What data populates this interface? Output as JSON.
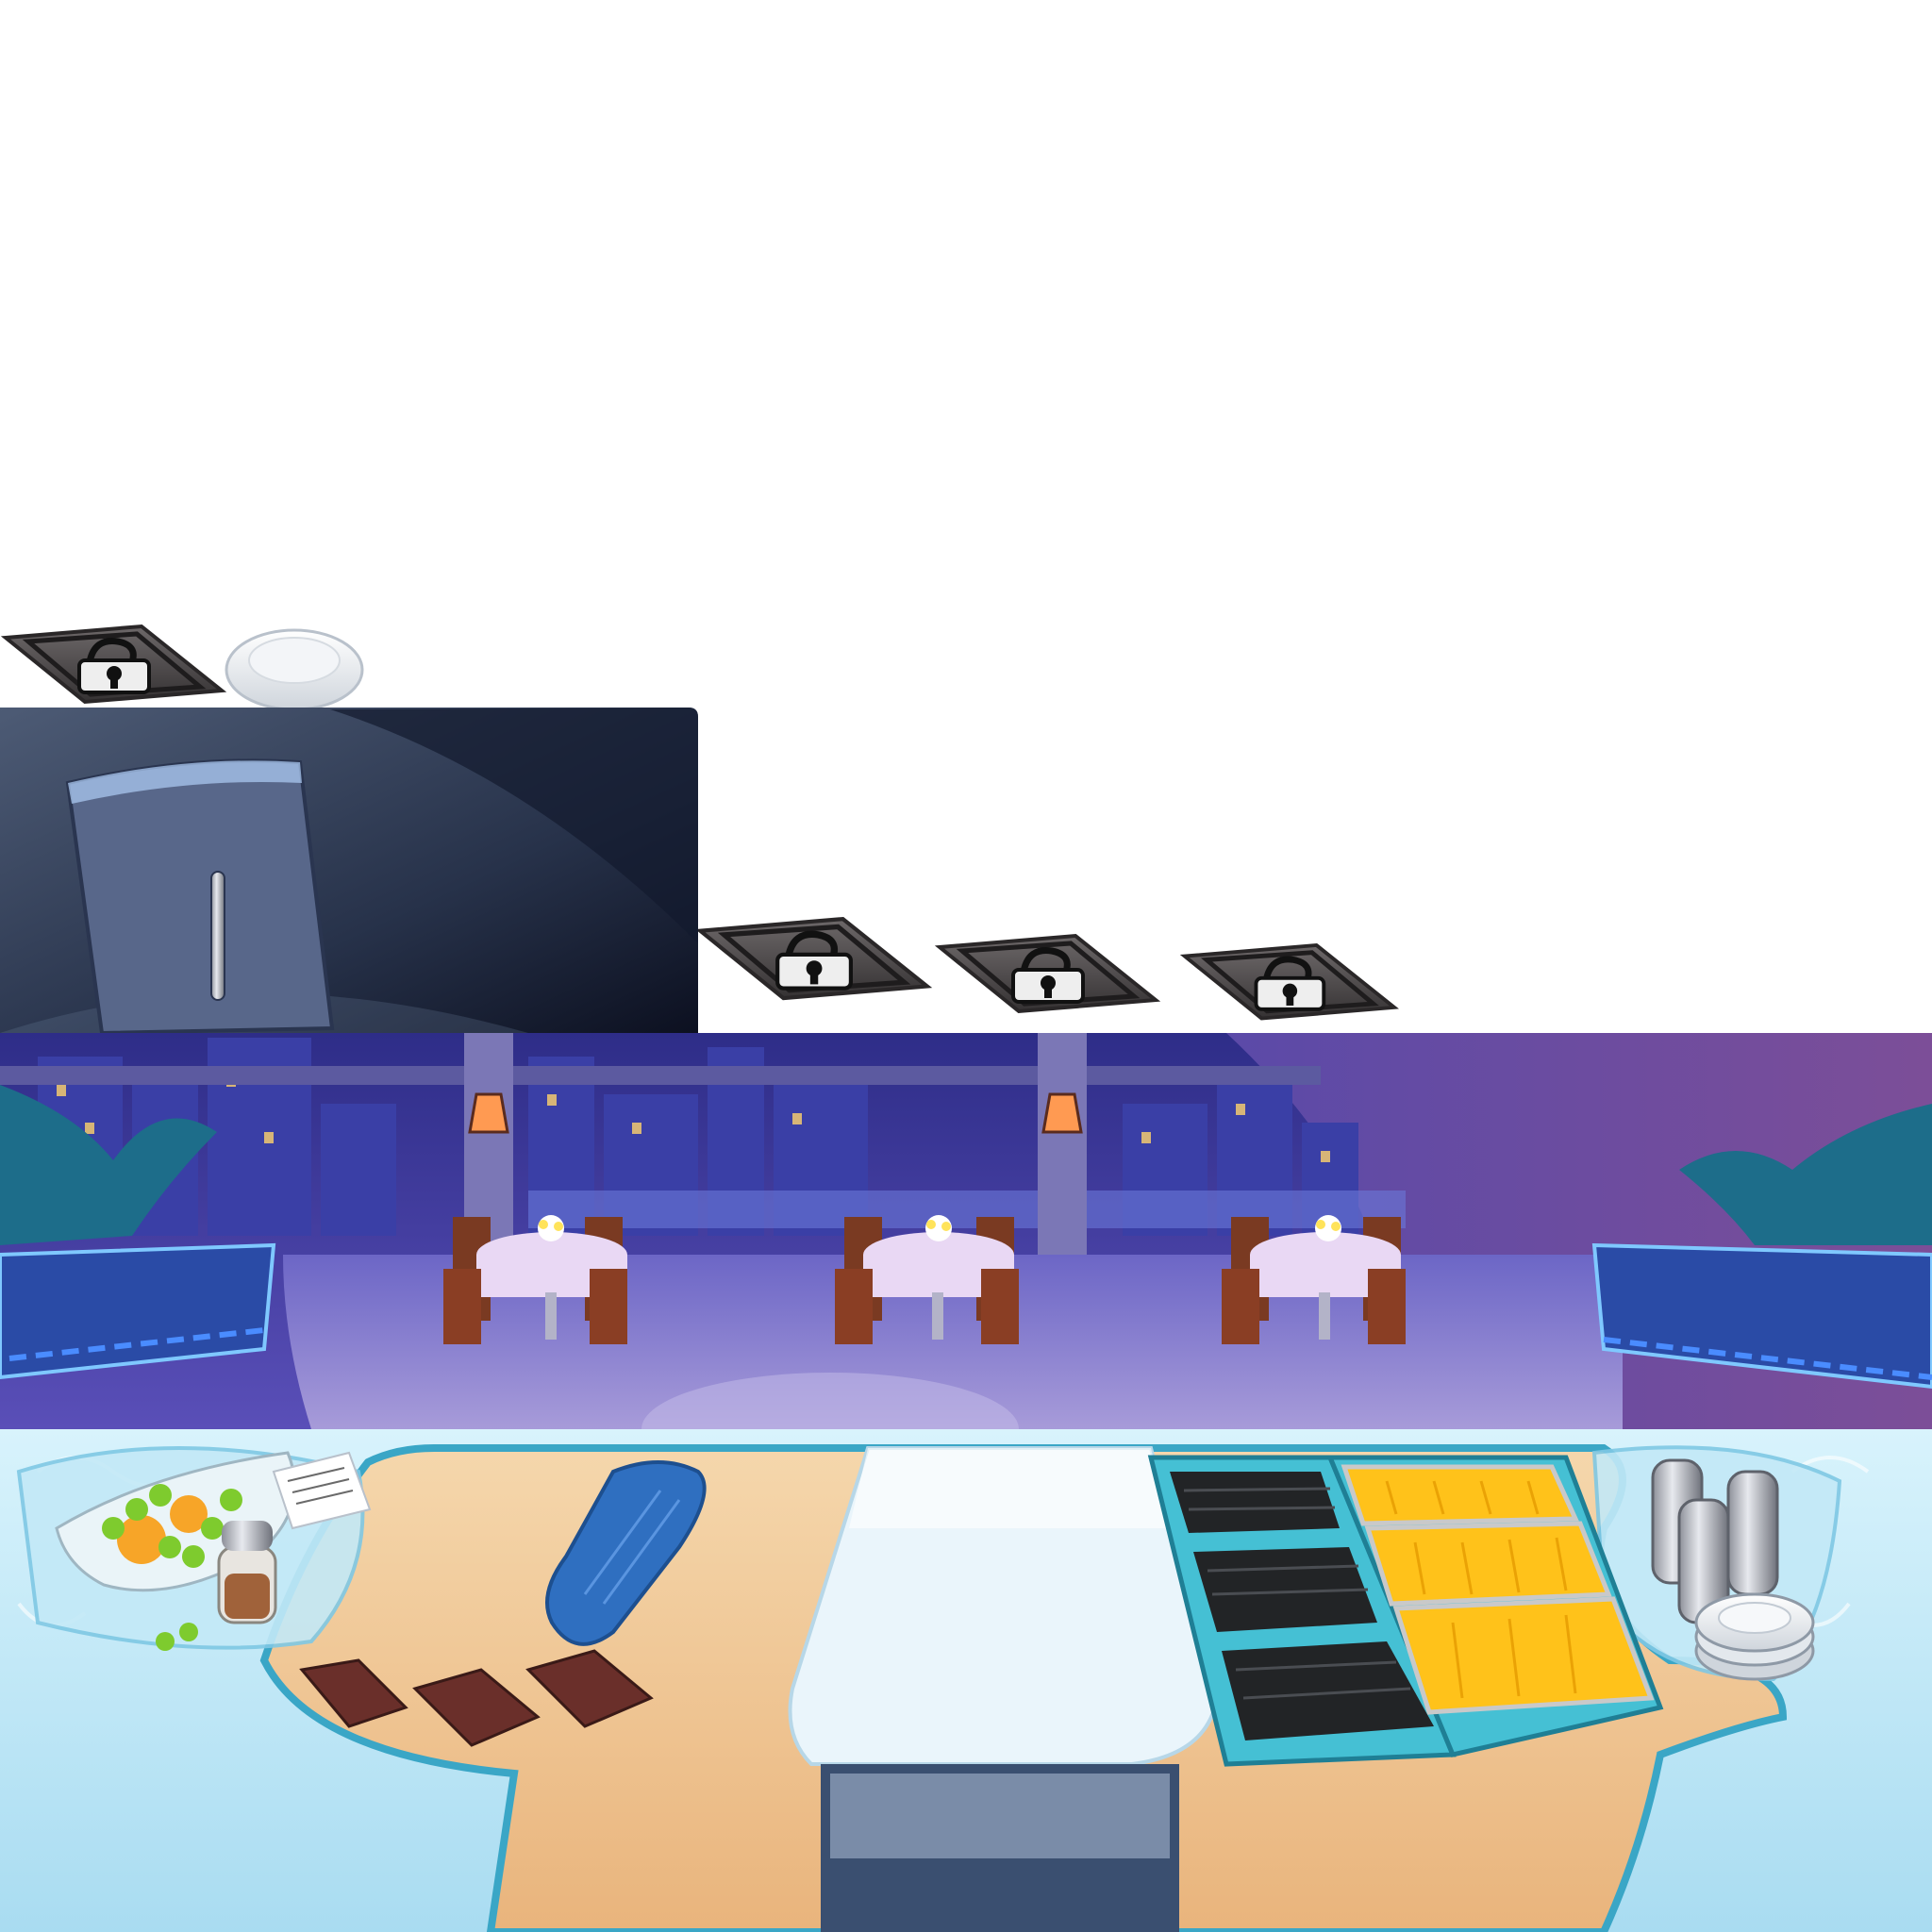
{
  "atlas": {
    "lock_slots": [
      {
        "id": "lock-slot-1",
        "locked": true
      },
      {
        "id": "lock-slot-2",
        "locked": true
      },
      {
        "id": "lock-slot-3",
        "locked": true
      },
      {
        "id": "lock-slot-4",
        "locked": true
      }
    ],
    "icons": {
      "lock": "padlock-icon",
      "plate": "plate-icon",
      "lamp": "wall-lamp-icon",
      "flowers": "flower-vase-icon"
    },
    "dining_tables": 3,
    "grill_plates": 3,
    "fryer_baskets": 3,
    "coasters": 3,
    "salt_shakers": 3,
    "plate_stack": 3
  },
  "colors": {
    "night_sky": "#2a2f8a",
    "floor": "#8a7fd0",
    "counter_wood": "#f0c99a",
    "counter_trim": "#3aa6c6",
    "tile_bg": "#bfe7f6",
    "lock_metal": "#4e4a4b",
    "fridge": "#3c4a63",
    "fries": "#ffc21a"
  }
}
